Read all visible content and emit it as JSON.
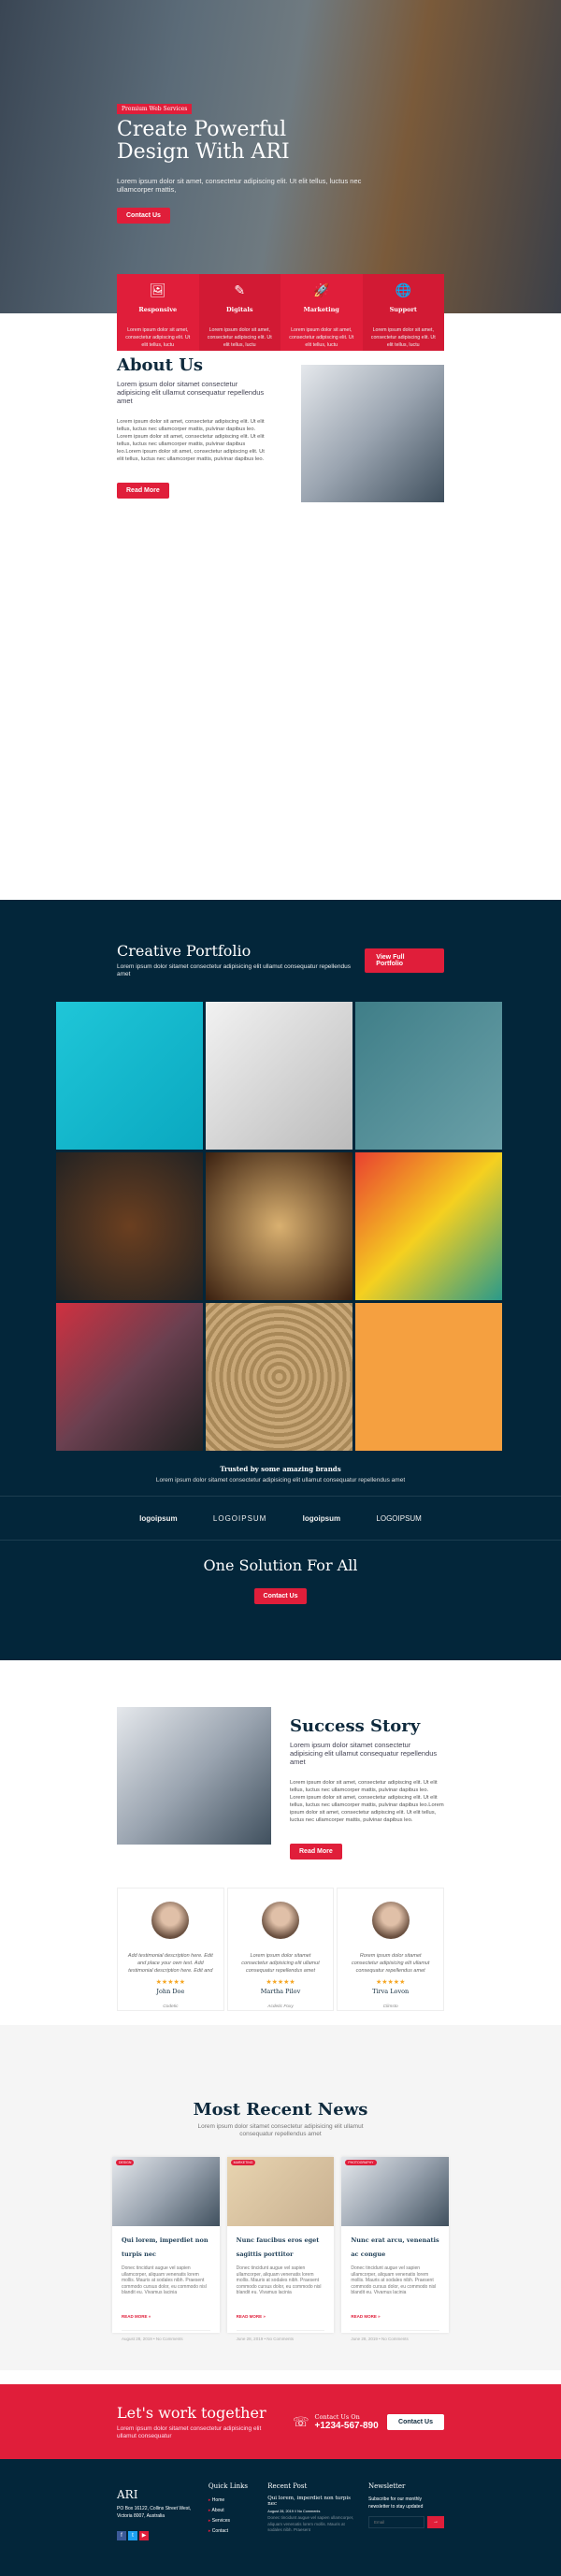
{
  "hero": {
    "badge": "Premium Web Services",
    "title_1": "Create Powerful",
    "title_2": "Design With ARI",
    "text": "Lorem ipsum dolor sit amet, consectetur adipiscing elit. Ut elit tellus, luctus nec ullamcorper mattis,",
    "button": "Contact Us"
  },
  "features": [
    {
      "icon": "presentation-board-icon",
      "title": "Responsive",
      "text": "Lorem ipsum dolor sit amet, consectetur adipiscing elit. Ut elit tellus, luctu"
    },
    {
      "icon": "pencil-cup-icon",
      "title": "Digitals",
      "text": "Lorem ipsum dolor sit amet, consectetur adipiscing elit. Ut elit tellus, luctu"
    },
    {
      "icon": "rocket-icon",
      "title": "Marketing",
      "text": "Lorem ipsum dolor sit amet, consectetur adipiscing elit. Ut elit tellus, luctu"
    },
    {
      "icon": "globe-support-icon",
      "title": "Support",
      "text": "Lorem ipsum dolor sit amet, consectetur adipiscing elit. Ut elit tellus, luctu"
    }
  ],
  "about": {
    "title": "About Us",
    "subtitle": "Lorem ipsum dolor sitamet consectetur adipisicing elit ullamut consequatur repellendus amet",
    "body": "Lorem ipsum dolor sit amet, consectetur adipiscing elit. Ut elit tellus, luctus nec ullamcorper mattis, pulvinar dapibus leo. Lorem ipsum dolor sit amet, consectetur adipiscing elit. Ut elit tellus, luctus nec ullamcorper mattis, pulvinar dapibus leo.Lorem ipsum dolor sit amet, consectetur adipiscing elit. Ut elit tellus, luctus nec ullamcorper mattis, pulvinar dapibus leo.",
    "button": "Read More"
  },
  "portfolio": {
    "title": "Creative Portfolio",
    "subtitle": "Lorem ipsum dolor sitamet consectetur adipisicing elit ullamut consequatur repellendus amet",
    "button": "View Full Portfolio"
  },
  "trusted": {
    "title": "Trusted by some amazing brands",
    "text": "Lorem ipsum dolor sitamet consectetur adipisicing elit ullamut consequatur repellendus amet",
    "logos": [
      "logoipsum",
      "LOGOIPSUM",
      "logoipsum",
      "LOGOIPSUM"
    ]
  },
  "solution": {
    "title": "One Solution For All",
    "button": "Contact Us"
  },
  "success": {
    "title": "Success Story",
    "subtitle": "Lorem ipsum dolor sitamet consectetur adipisicing elit ullamut consequatur repellendus amet",
    "body": "Lorem ipsum dolor sit amet, consectetur adipiscing elit. Ut elit tellus, luctus nec ullamcorper mattis, pulvinar dapibus leo. Lorem ipsum dolor sit amet, consectetur adipiscing elit. Ut elit tellus, luctus nec ullamcorper mattis, pulvinar dapibus leo.Lorem ipsum dolor sit amet, consectetur adipiscing elit. Ut elit tellus, luctus nec ullamcorper mattis, pulvinar dapibus leo.",
    "button": "Read More"
  },
  "testimonials": [
    {
      "text": "Add testimonial description here. Edit and place your own text. Add testimonial description here. Edit and",
      "stars": "★★★★★",
      "rating": 5,
      "name": "John Doe",
      "role": "Codetic"
    },
    {
      "text": "Lorem ipsum dolor sitamet consectetur adipisicing elit ullamut consequatur repellendus amet",
      "stars": "★★★★★",
      "rating": 5,
      "name": "Martha Pilov",
      "role": "Acdetic Foxy"
    },
    {
      "text": "Rorem ipsum dolor sitamet consectetur adipisicing elit ullamut consequatur repellendus amet",
      "stars": "★★★★★",
      "rating": 5,
      "name": "Tirva Lovon",
      "role": "Climsto"
    }
  ],
  "news": {
    "title": "Most Recent News",
    "subtitle": "Lorem ipsum dolor sitamet consectetur adipisicing elit ullamut consequatur repellendus amet",
    "posts": [
      {
        "category": "DESIGN",
        "title": "Qui lorem, imperdiet non turpis nec",
        "text": "Donec tincidunt augue vel sapien ullamcorper, aliquam venenatis lorem mollis. Mauris at sodales nibh. Praesent commodo cursus dolor, eu commodo nisl blandit eu. Vivamus lacinia",
        "more": "READ MORE »",
        "meta": "August 28, 2019 • No Comments"
      },
      {
        "category": "MARKETING",
        "title": "Nunc faucibus eros eget sagittis porttitor",
        "text": "Donec tincidunt augue vel sapien ullamcorper, aliquam venenatis lorem mollis. Mauris at sodales nibh. Praesent commodo cursus dolor, eu commodo nisl blandit eu. Vivamus lacinia",
        "more": "READ MORE »",
        "meta": "June 28, 2019 • No Comments"
      },
      {
        "category": "PHOTOGRAPHY",
        "title": "Nunc erat arcu, venenatis ac congue",
        "text": "Donec tincidunt augue vel sapien ullamcorper, aliquam venenatis lorem mollis. Mauris at sodales nibh. Praesent commodo cursus dolor, eu commodo nisl blandit eu. Vivamus lacinia",
        "more": "READ MORE »",
        "meta": "June 28, 2019 • No Comments"
      }
    ]
  },
  "cta": {
    "title": "Let's work together",
    "text": "Lorem ipsum dolor sitamet consectetur adipisicing elit ullamut consequatur",
    "contact_label": "Contact Us On",
    "phone": "+1234-567-890",
    "button": "Contact Us"
  },
  "footer": {
    "brand": "ARI",
    "address": "PO Box 16122, Collins Street West, Victoria 8007, Australia",
    "quick_title": "Quick Links",
    "links": [
      "Home",
      "About",
      "Services",
      "Contact"
    ],
    "recent_title": "Recent Post",
    "recent_post": "Qui lorem, imperdiet non turpis nec",
    "recent_meta": "August 28, 2019 // No Comments",
    "recent_text": "Donec tincidunt augue vel sapien ullamcorper, aliquam venenatis lorem mollis. Mauris at sodales nibh. Praesent",
    "news_title": "Newsletter",
    "news_text": "Subscribe for our monthly newsletter to stay updated",
    "email_placeholder": "Email"
  },
  "colors": {
    "accent": "#e01e3a",
    "dark": "#03263a"
  }
}
